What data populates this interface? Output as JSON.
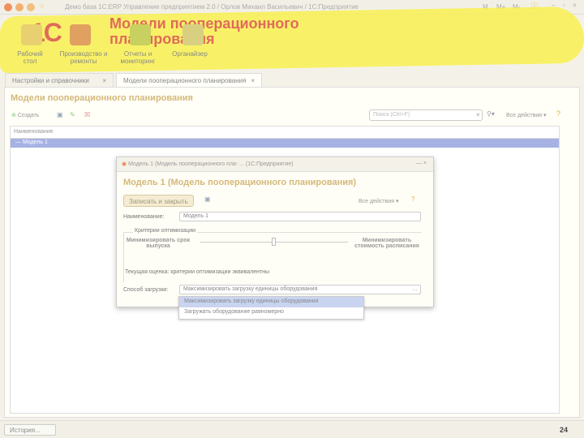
{
  "window": {
    "title": "Демо база 1С:ERP Управление предприятием 2.0 / Орлов Михаил Васильевич / 1С:Предприятие",
    "buttons": [
      "M",
      "M+",
      "M-"
    ]
  },
  "slide_title": "Модели пооперационного планирования",
  "nav": [
    {
      "label": "Рабочий стол"
    },
    {
      "label": "Производство и ремонты"
    },
    {
      "label": "Отчеты и мониторинг"
    },
    {
      "label": "Органайзер"
    }
  ],
  "tabs": [
    {
      "label": "Настройки и справочники"
    },
    {
      "label": "Модели пооперационного планирования"
    }
  ],
  "page": {
    "title": "Модели пооперационного планирования",
    "create": "Создать",
    "search_placeholder": "Поиск (Ctrl+F)",
    "all_actions": "Все действия ▾",
    "help": "?"
  },
  "table": {
    "header": "Наименование",
    "rows": [
      {
        "name": "Модель 1"
      }
    ]
  },
  "dialog": {
    "window_title": "Модель 1 (Модель пооперационного пла- ... (1С:Предприятие)",
    "title": "Модель 1 (Модель пооперационного планирования)",
    "save_close": "Записать и закрыть",
    "all_actions": "Все действия ▾",
    "name_label": "Наименование:",
    "name_value": "Модель 1",
    "group_label": "Критерии оптимизации",
    "left_criterion": "Минимизировать срок выпуска",
    "right_criterion": "Минимизировать стоимость расписания",
    "slider_value": 0.5,
    "estimate": "Текущая оценка: критерии оптимизации эквивалентны",
    "load_label": "Способ загрузки:",
    "load_value": "Максимизировать загрузку единицы оборудования",
    "options": [
      "Максимизировать загрузку единицы оборудования",
      "Загружать оборудование равномерно"
    ]
  },
  "footer": {
    "history": "История...",
    "page_number": "24"
  }
}
